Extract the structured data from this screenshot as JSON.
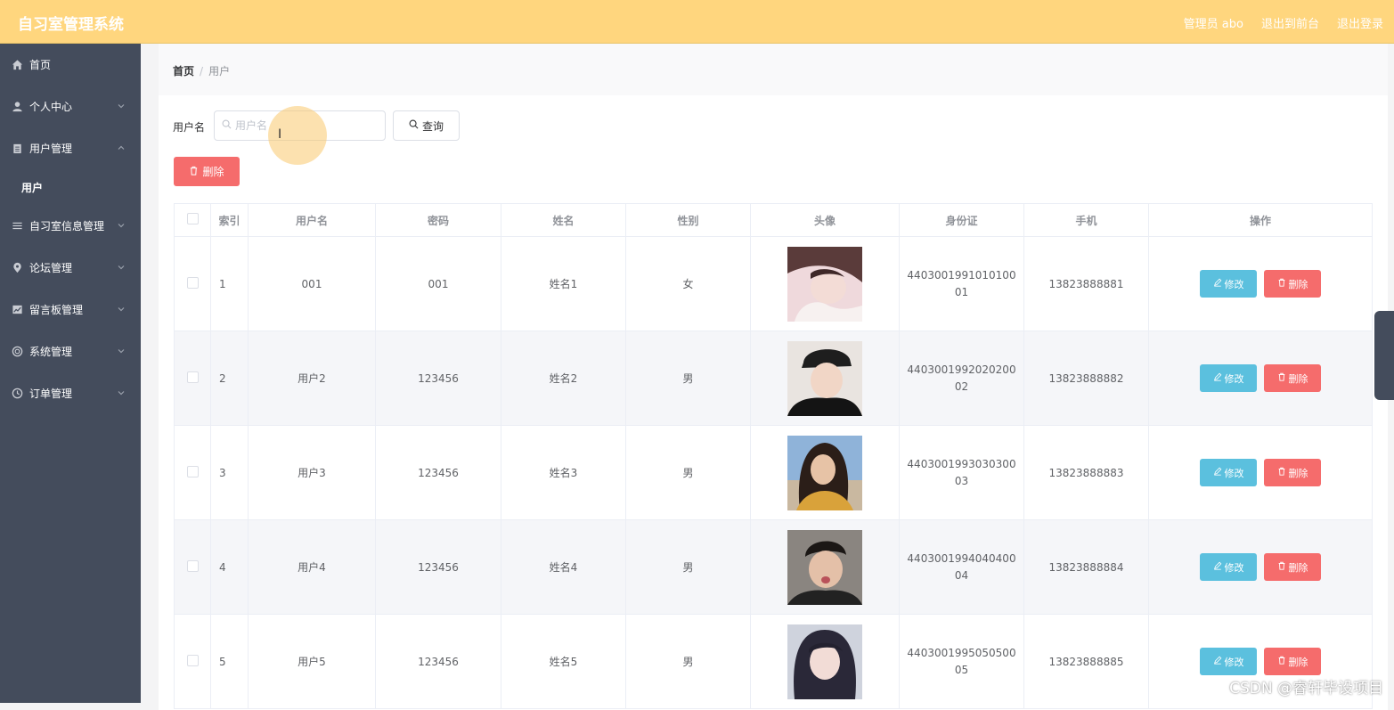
{
  "header": {
    "title": "自习室管理系统",
    "admin_label": "管理员 abo",
    "front_link": "退出到前台",
    "logout_link": "退出登录",
    "bg_color": "#ffd67e"
  },
  "sidebar": {
    "items": [
      {
        "label": "首页",
        "icon": "home-icon"
      },
      {
        "label": "个人中心",
        "icon": "user-icon"
      },
      {
        "label": "用户管理",
        "icon": "clipboard-icon"
      },
      {
        "label": "用户",
        "icon": ""
      },
      {
        "label": "自习室信息管理",
        "icon": "list-icon"
      },
      {
        "label": "论坛管理",
        "icon": "location-icon"
      },
      {
        "label": "留言板管理",
        "icon": "chart-icon"
      },
      {
        "label": "系统管理",
        "icon": "lifebuoy-icon"
      },
      {
        "label": "订单管理",
        "icon": "clock-icon"
      }
    ],
    "bg_color": "#444c5c"
  },
  "breadcrumb": {
    "home": "首页",
    "current": "用户"
  },
  "search": {
    "label": "用户名",
    "placeholder": "用户名",
    "query_button": "查询"
  },
  "toolbar": {
    "delete_label": "删除"
  },
  "table": {
    "headers": [
      "索引",
      "用户名",
      "密码",
      "姓名",
      "性别",
      "头像",
      "身份证",
      "手机",
      "操作"
    ],
    "rows": [
      {
        "index": "1",
        "username": "001",
        "password": "001",
        "name": "姓名1",
        "gender": "女",
        "id_card": "440300199101010001",
        "phone": "13823888881"
      },
      {
        "index": "2",
        "username": "用户2",
        "password": "123456",
        "name": "姓名2",
        "gender": "男",
        "id_card": "440300199202020002",
        "phone": "13823888882"
      },
      {
        "index": "3",
        "username": "用户3",
        "password": "123456",
        "name": "姓名3",
        "gender": "男",
        "id_card": "440300199303030003",
        "phone": "13823888883"
      },
      {
        "index": "4",
        "username": "用户4",
        "password": "123456",
        "name": "姓名4",
        "gender": "男",
        "id_card": "440300199404040004",
        "phone": "13823888884"
      },
      {
        "index": "5",
        "username": "用户5",
        "password": "123456",
        "name": "姓名5",
        "gender": "男",
        "id_card": "440300199505050005",
        "phone": "13823888885"
      }
    ],
    "edit_label": "修改",
    "delete_label": "删除"
  },
  "watermark": "CSDN @睿轩毕设项目"
}
